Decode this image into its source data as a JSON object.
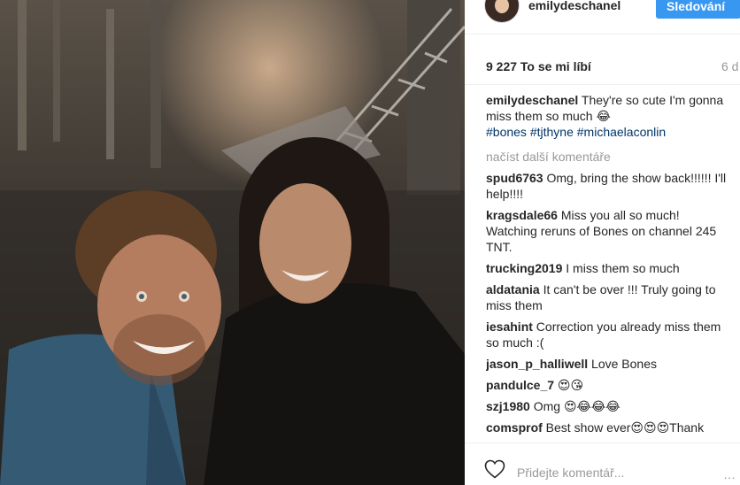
{
  "post": {
    "username": "emilydeschanel",
    "follow_label": "Sledování",
    "likes": "9 227 To se mi líbí",
    "time": "6 d",
    "caption_user": "emilydeschanel",
    "caption_text": " They're so cute I'm gonna miss them so much 😂",
    "hashtags": [
      "#bones",
      "#tjthyne",
      "#michaelaconlin"
    ],
    "load_more": "načíst další komentáře",
    "add_comment_placeholder": "Přidejte komentář...",
    "more": "…"
  },
  "comments": [
    {
      "user": "spud6763",
      "text": " Omg, bring the show back!!!!!! I'll help!!!!"
    },
    {
      "user": "kragsdale66",
      "text": " Miss you all so much! Watching reruns of Bones on channel 245 TNT."
    },
    {
      "user": "trucking2019",
      "text": " I miss them so much"
    },
    {
      "user": "aldatania",
      "text": " It can't be over !!! Truly going to miss them"
    },
    {
      "user": "iesahint",
      "text": " Correction you already miss them so much :("
    },
    {
      "user": "jason_p_halliwell",
      "text": " Love Bones"
    },
    {
      "user": "pandulce_7",
      "text": " 😍😘"
    },
    {
      "user": "szj1980",
      "text": " Omg 😍😂😂😂"
    },
    {
      "user": "comsprof",
      "text": " Best show ever😍😍😍Thank"
    }
  ],
  "icons": {
    "heart": "heart-icon",
    "more": "more-options-icon"
  }
}
